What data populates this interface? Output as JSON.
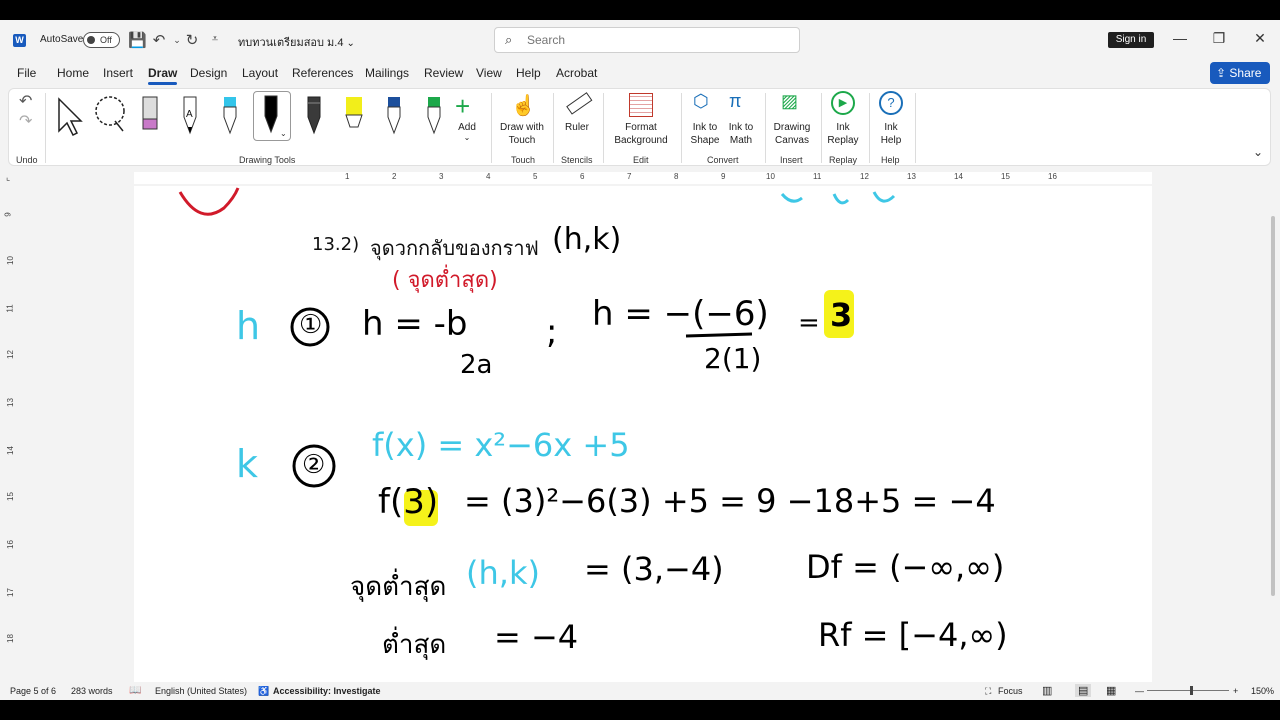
{
  "titlebar": {
    "autosave_label": "AutoSave",
    "autosave_state": "Off",
    "doc_title": "ทบทวนเตรียมสอบ ม.4",
    "search_placeholder": "Search",
    "signin": "Sign in"
  },
  "menu": {
    "tabs": [
      "File",
      "Home",
      "Insert",
      "Draw",
      "Design",
      "Layout",
      "References",
      "Mailings",
      "Review",
      "View",
      "Help",
      "Acrobat"
    ],
    "active": "Draw",
    "share": "Share"
  },
  "ribbon": {
    "groups": {
      "undo": "Undo",
      "drawing_tools": "Drawing Tools",
      "touch": "Touch",
      "stencils": "Stencils",
      "edit": "Edit",
      "convert": "Convert",
      "insert": "Insert",
      "replay": "Replay",
      "help": "Help"
    },
    "buttons": {
      "add": "Add",
      "draw_with_touch_1": "Draw with",
      "draw_with_touch_2": "Touch",
      "ruler": "Ruler",
      "format_bg_1": "Format",
      "format_bg_2": "Background",
      "ink_to_shape_1": "Ink to",
      "ink_to_shape_2": "Shape",
      "ink_to_math_1": "Ink to",
      "ink_to_math_2": "Math",
      "drawing_canvas_1": "Drawing",
      "drawing_canvas_2": "Canvas",
      "ink_replay_1": "Ink",
      "ink_replay_2": "Replay",
      "ink_help_1": "Ink",
      "ink_help_2": "Help"
    },
    "pen_colors": [
      "#c879c8",
      "#000000",
      "#33c5ea",
      "#000000",
      "#3a3a3a",
      "#f2ee1a",
      "#1c4f9c",
      "#1ca84a"
    ]
  },
  "ruler": {
    "numbers": [
      "1",
      "2",
      "3",
      "4",
      "5",
      "6",
      "7",
      "8",
      "9",
      "10",
      "11",
      "12",
      "13",
      "14",
      "15",
      "16"
    ],
    "vnumbers": [
      "9",
      "10",
      "11",
      "12",
      "13",
      "14",
      "15",
      "16",
      "17",
      "18"
    ]
  },
  "document": {
    "item_number": "13.2)",
    "item_text": "จุดวกกลับของกราฟ",
    "ink": {
      "hk_pair": "(h,k)",
      "min_point_note": "( จุดต่ำสุด)",
      "h_label": "h",
      "step1": "①",
      "h_formula_left": "h = -b",
      "h_formula_den": "2a",
      "semicolon": ";",
      "h_sub_num": "h = −(−6)",
      "h_sub_den": "2(1)",
      "equals": "=",
      "h_result": "3",
      "k_label": "k",
      "step2": "②",
      "fx_def": "f(x) = x²−6x +5",
      "f_prefix": "f(",
      "f_arg": "3",
      "f_suffix": ")",
      "f_eval": "= (3)²−6(3) +5 =   9 −18+5  = −4",
      "min_point_label": "จุดต่ำสุด",
      "min_point_hk": "(h,k)",
      "min_point_value": "= (3,−4)",
      "domain": "Df = (−∞,∞)",
      "min_value_label": "ต่ำสุด",
      "min_value": "=    −4",
      "range": "Rf = [−4,∞)"
    }
  },
  "statusbar": {
    "page": "Page 5 of 6",
    "words": "283 words",
    "language": "English (United States)",
    "accessibility": "Accessibility: Investigate",
    "focus": "Focus",
    "zoom": "150%"
  }
}
